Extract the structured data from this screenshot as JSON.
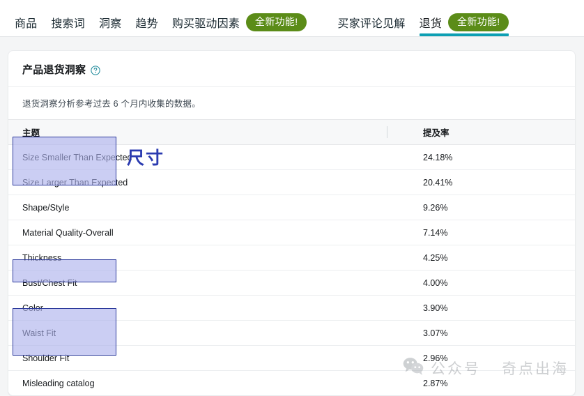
{
  "nav": {
    "tabs": [
      {
        "label": "商品",
        "badge": null,
        "active": false
      },
      {
        "label": "搜索词",
        "badge": null,
        "active": false
      },
      {
        "label": "洞察",
        "badge": null,
        "active": false
      },
      {
        "label": "趋势",
        "badge": null,
        "active": false
      },
      {
        "label": "购买驱动因素",
        "badge": "全新功能!",
        "active": false
      },
      {
        "label": "买家评论见解",
        "badge": null,
        "active": false
      },
      {
        "label": "退货",
        "badge": "全新功能!",
        "active": true
      }
    ],
    "badge_color": "#5b8c18",
    "active_underline_color": "#0d9fb3"
  },
  "card": {
    "title": "产品退货洞察",
    "help_icon": "question-circle-icon",
    "subtitle": "退货洞察分析参考过去 6 个月内收集的数据。"
  },
  "table": {
    "columns": [
      {
        "key": "theme",
        "label": "主题"
      },
      {
        "key": "rate",
        "label": "提及率"
      }
    ],
    "rows": [
      {
        "theme": "Size Smaller Than Expected",
        "rate": "24.18%"
      },
      {
        "theme": "Size Larger Than Expected",
        "rate": "20.41%"
      },
      {
        "theme": "Shape/Style",
        "rate": "9.26%"
      },
      {
        "theme": "Material Quality-Overall",
        "rate": "7.14%"
      },
      {
        "theme": "Thickness",
        "rate": "4.25%"
      },
      {
        "theme": "Bust/Chest Fit",
        "rate": "4.00%"
      },
      {
        "theme": "Color",
        "rate": "3.90%"
      },
      {
        "theme": "Waist Fit",
        "rate": "3.07%"
      },
      {
        "theme": "Shoulder Fit",
        "rate": "2.96%"
      },
      {
        "theme": "Misleading catalog",
        "rate": "2.87%"
      }
    ]
  },
  "annotations": {
    "size_label": "尺寸",
    "highlight_fill": "#abb0ec",
    "highlight_border": "#2c3a9c",
    "annotation_color": "#2b3bb0"
  },
  "watermark": {
    "icon": "wechat-icon",
    "prefix": "公众号",
    "name": "奇点出海"
  }
}
